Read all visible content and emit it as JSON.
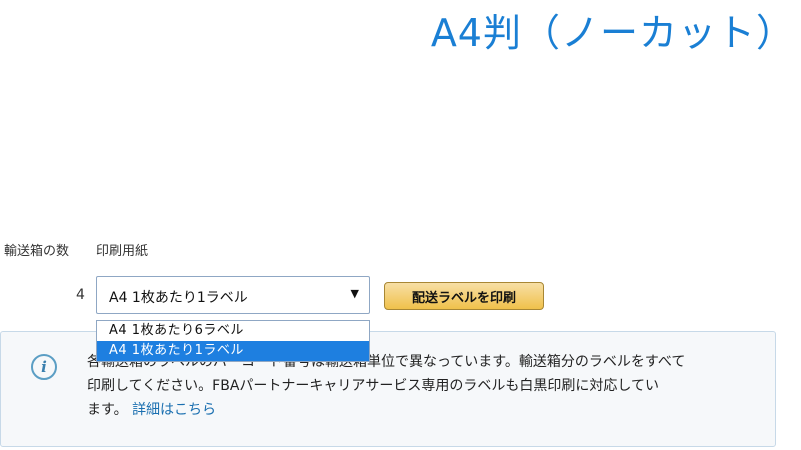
{
  "banner": {
    "title": "A4判（ノーカット）"
  },
  "columns": {
    "boxes_header": "輸送箱の数",
    "paper_header": "印刷用紙"
  },
  "row": {
    "box_count": "4"
  },
  "paper_select": {
    "selected": "A4 1枚あたり1ラベル",
    "arrow_icon": "dropdown-triangle",
    "options": [
      {
        "label": "A4 1枚あたり6ラベル",
        "selected": false
      },
      {
        "label": "A4 1枚あたり1ラベル",
        "selected": true
      }
    ]
  },
  "print_button": {
    "label": "配送ラベルを印刷"
  },
  "info": {
    "icon": "i",
    "text_line1": "各輸送箱のラベルのバーコード番号は輸送箱単位で異なっています。輸送箱分のラベルをすべて",
    "text_line2": "印刷してください。FBAパートナーキャリアサービス専用のラベルも白黒印刷に対応してい",
    "text_line3": "ます。",
    "link": "詳細はこちら"
  },
  "colors": {
    "accent": "#1a7fd4",
    "selection": "#1e7fe0",
    "button_top": "#f7dfa5",
    "button_bottom": "#f0c14b",
    "link": "#1a6fb0"
  }
}
